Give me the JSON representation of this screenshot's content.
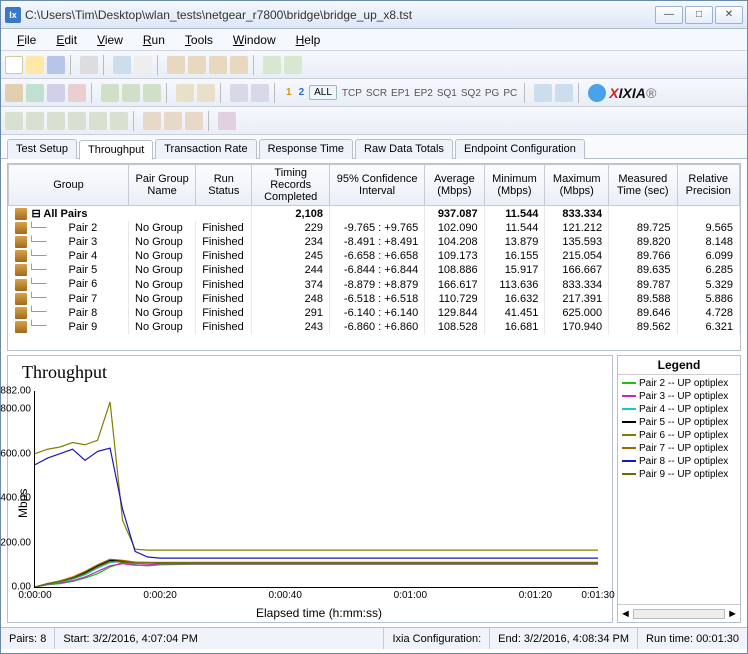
{
  "window": {
    "title": "C:\\Users\\Tim\\Desktop\\wlan_tests\\netgear_r7800\\bridge\\bridge_up_x8.tst",
    "app_icon_label": "IxC"
  },
  "menu": {
    "items": [
      "File",
      "Edit",
      "View",
      "Run",
      "Tools",
      "Window",
      "Help"
    ]
  },
  "toolbar2": {
    "all_btn": "ALL",
    "labels": [
      "TCP",
      "SCR",
      "EP1",
      "EP2",
      "SQ1",
      "SQ2",
      "PG",
      "PC"
    ],
    "brand_x": "X",
    "brand_rest": "IXIA"
  },
  "tabs": [
    "Test Setup",
    "Throughput",
    "Transaction Rate",
    "Response Time",
    "Raw Data Totals",
    "Endpoint Configuration"
  ],
  "active_tab": 1,
  "grid": {
    "headers": [
      "Group",
      "Pair Group Name",
      "Run Status",
      "Timing Records Completed",
      "95% Confidence Interval",
      "Average (Mbps)",
      "Minimum (Mbps)",
      "Maximum (Mbps)",
      "Measured Time (sec)",
      "Relative Precision"
    ],
    "summary": {
      "label": "All Pairs",
      "timing": "2,108",
      "avg": "937.087",
      "min": "11.544",
      "max": "833.334"
    },
    "rows": [
      {
        "name": "Pair 2",
        "group": "No Group",
        "status": "Finished",
        "timing": "229",
        "ci": "-9.765 : +9.765",
        "avg": "102.090",
        "min": "11.544",
        "max": "121.212",
        "time": "89.725",
        "prec": "9.565"
      },
      {
        "name": "Pair 3",
        "group": "No Group",
        "status": "Finished",
        "timing": "234",
        "ci": "-8.491 : +8.491",
        "avg": "104.208",
        "min": "13.879",
        "max": "135.593",
        "time": "89.820",
        "prec": "8.148"
      },
      {
        "name": "Pair 4",
        "group": "No Group",
        "status": "Finished",
        "timing": "245",
        "ci": "-6.658 : +6.658",
        "avg": "109.173",
        "min": "16.155",
        "max": "215.054",
        "time": "89.766",
        "prec": "6.099"
      },
      {
        "name": "Pair 5",
        "group": "No Group",
        "status": "Finished",
        "timing": "244",
        "ci": "-6.844 : +6.844",
        "avg": "108.886",
        "min": "15.917",
        "max": "166.667",
        "time": "89.635",
        "prec": "6.285"
      },
      {
        "name": "Pair 6",
        "group": "No Group",
        "status": "Finished",
        "timing": "374",
        "ci": "-8.879 : +8.879",
        "avg": "166.617",
        "min": "113.636",
        "max": "833.334",
        "time": "89.787",
        "prec": "5.329"
      },
      {
        "name": "Pair 7",
        "group": "No Group",
        "status": "Finished",
        "timing": "248",
        "ci": "-6.518 : +6.518",
        "avg": "110.729",
        "min": "16.632",
        "max": "217.391",
        "time": "89.588",
        "prec": "5.886"
      },
      {
        "name": "Pair 8",
        "group": "No Group",
        "status": "Finished",
        "timing": "291",
        "ci": "-6.140 : +6.140",
        "avg": "129.844",
        "min": "41.451",
        "max": "625.000",
        "time": "89.646",
        "prec": "4.728"
      },
      {
        "name": "Pair 9",
        "group": "No Group",
        "status": "Finished",
        "timing": "243",
        "ci": "-6.860 : +6.860",
        "avg": "108.528",
        "min": "16.681",
        "max": "170.940",
        "time": "89.562",
        "prec": "6.321"
      }
    ]
  },
  "chart": {
    "title": "Throughput",
    "ylabel": "Mbps",
    "xlabel": "Elapsed time (h:mm:ss)",
    "yticks": [
      "882.00",
      "800.00",
      "600.00",
      "400.00",
      "200.00",
      "0.00"
    ],
    "xticks": [
      "0:00:00",
      "0:00:20",
      "0:00:40",
      "0:01:00",
      "0:01:20",
      "0:01:30"
    ]
  },
  "chart_data": {
    "type": "line",
    "title": "Throughput",
    "xlabel": "Elapsed time (h:mm:ss)",
    "ylabel": "Mbps",
    "ylim": [
      0,
      882
    ],
    "x_seconds": [
      0,
      2,
      4,
      6,
      8,
      10,
      12,
      14,
      16,
      18,
      20,
      25,
      30,
      40,
      50,
      60,
      70,
      80,
      90
    ],
    "series": [
      {
        "name": "Pair 2 -- UP optiplex",
        "color": "#18c218",
        "values": [
          0,
          10,
          15,
          25,
          40,
          60,
          90,
          110,
          100,
          95,
          100,
          102,
          102,
          102,
          102,
          102,
          102,
          102,
          102
        ]
      },
      {
        "name": "Pair 3 -- UP optiplex",
        "color": "#c028c0",
        "values": [
          0,
          12,
          18,
          28,
          45,
          70,
          95,
          105,
          98,
          100,
          104,
          104,
          104,
          104,
          104,
          104,
          104,
          104,
          104
        ]
      },
      {
        "name": "Pair 4 -- UP optiplex",
        "color": "#18c8c8",
        "values": [
          0,
          14,
          22,
          35,
          55,
          85,
          110,
          115,
          105,
          108,
          109,
          109,
          109,
          109,
          109,
          109,
          109,
          109,
          109
        ]
      },
      {
        "name": "Pair 5 -- UP optiplex",
        "color": "#000000",
        "values": [
          0,
          15,
          25,
          40,
          65,
          95,
          120,
          118,
          110,
          109,
          109,
          109,
          109,
          109,
          109,
          109,
          109,
          109,
          109
        ]
      },
      {
        "name": "Pair 6 -- UP optiplex",
        "color": "#808000",
        "values": [
          600,
          620,
          630,
          650,
          640,
          660,
          833,
          300,
          170,
          166,
          166,
          166,
          166,
          166,
          166,
          166,
          166,
          166,
          166
        ]
      },
      {
        "name": "Pair 7 -- UP optiplex",
        "color": "#9c6a00",
        "values": [
          0,
          16,
          28,
          45,
          70,
          100,
          125,
          120,
          112,
          111,
          111,
          111,
          111,
          111,
          111,
          111,
          111,
          111,
          111
        ]
      },
      {
        "name": "Pair 8 -- UP optiplex",
        "color": "#1818b8",
        "values": [
          550,
          580,
          600,
          620,
          570,
          610,
          625,
          350,
          160,
          135,
          130,
          130,
          130,
          130,
          130,
          130,
          130,
          130,
          130
        ]
      },
      {
        "name": "Pair 9 -- UP optiplex",
        "color": "#6b6b00",
        "values": [
          0,
          15,
          24,
          38,
          60,
          90,
          115,
          112,
          108,
          108,
          108,
          108,
          108,
          108,
          108,
          108,
          108,
          108,
          108
        ]
      }
    ]
  },
  "legend": {
    "title": "Legend"
  },
  "status": {
    "pairs_label": "Pairs:",
    "pairs_value": "8",
    "start_label": "Start:",
    "start_value": "3/2/2016, 4:07:04 PM",
    "config_label": "Ixia Configuration:",
    "end_label": "End:",
    "end_value": "3/2/2016, 4:08:34 PM",
    "runtime_label": "Run time:",
    "runtime_value": "00:01:30"
  }
}
